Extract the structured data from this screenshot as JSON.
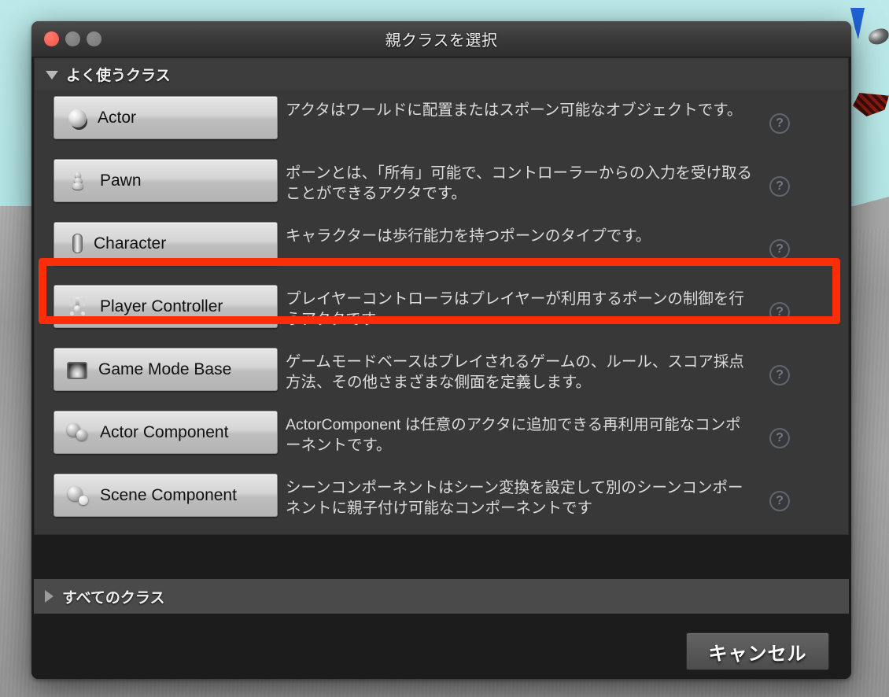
{
  "window": {
    "title": "親クラスを選択",
    "traffic_lights": {
      "close": "close",
      "minimize": "minimize",
      "zoom": "zoom"
    }
  },
  "common_classes": {
    "header_label": "よく使うクラス",
    "expanded": true,
    "items": [
      {
        "name": "Actor",
        "icon": "actor-sphere-icon",
        "description": "アクタはワールドに配置またはスポーン可能なオブジェクトです。",
        "help_glyph": "?",
        "highlighted": false
      },
      {
        "name": "Pawn",
        "icon": "pawn-icon",
        "description": "ポーンとは、「所有」可能で、コントローラーからの入力を受け取ることができるアクタです。",
        "help_glyph": "?",
        "highlighted": false
      },
      {
        "name": "Character",
        "icon": "character-capsule-icon",
        "description": "キャラクターは歩行能力を持つポーンのタイプです。",
        "help_glyph": "?",
        "highlighted": true
      },
      {
        "name": "Player Controller",
        "icon": "player-controller-icon",
        "description": "プレイヤーコントローラはプレイヤーが利用するポーンの制御を行うアクタです",
        "help_glyph": "?",
        "highlighted": false
      },
      {
        "name": "Game Mode Base",
        "icon": "game-mode-icon",
        "description": "ゲームモードベースはプレイされるゲームの、ルール、スコア採点方法、その他さまざまな側面を定義します。",
        "help_glyph": "?",
        "highlighted": false
      },
      {
        "name": "Actor Component",
        "icon": "actor-component-icon",
        "description": "ActorComponent は任意のアクタに追加できる再利用可能なコンポーネントです。",
        "help_glyph": "?",
        "highlighted": false
      },
      {
        "name": "Scene Component",
        "icon": "scene-component-icon",
        "description": "シーンコンポーネントはシーン変換を設定して別のシーンコンポーネントに親子付け可能なコンポーネントです",
        "help_glyph": "?",
        "highlighted": false
      }
    ]
  },
  "all_classes": {
    "header_label": "すべてのクラス",
    "expanded": false
  },
  "footer": {
    "cancel_label": "キャンセル"
  },
  "annotation": {
    "color": "#fb2e09",
    "target": "Character"
  },
  "background": {
    "sky_color": "#b8e8e8",
    "ground_color": "#a3a3a3",
    "marker_color": "#1f63d8"
  }
}
